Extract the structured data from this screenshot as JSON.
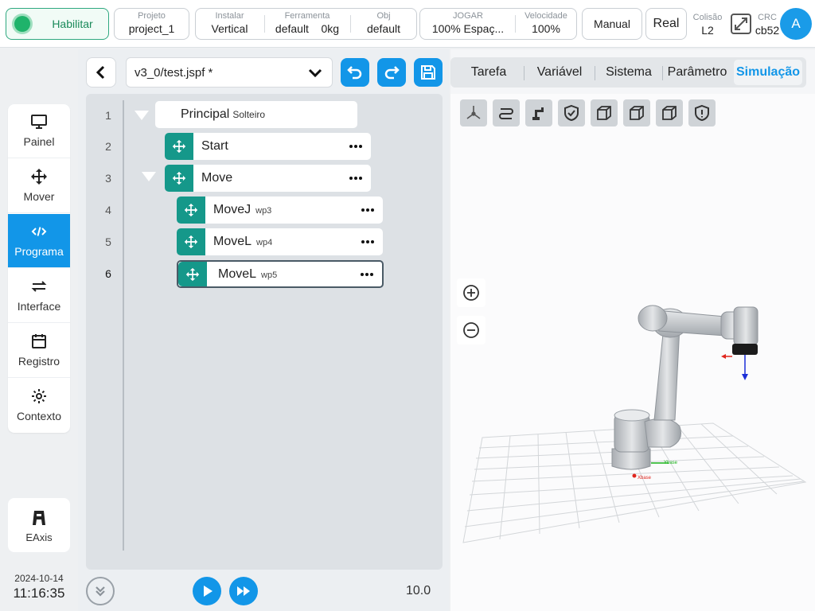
{
  "topbar": {
    "enable_label": "Habilitar",
    "project": {
      "key": "Projeto",
      "value": "project_1"
    },
    "install": {
      "key": "Instalar",
      "value": "Vertical"
    },
    "tool": {
      "key": "Ferramenta",
      "value_name": "default",
      "value_weight": "0kg"
    },
    "obj": {
      "key": "Obj",
      "value": "default"
    },
    "jog": {
      "key": "JOGAR",
      "value": "100%  Espaç..."
    },
    "speed": {
      "key": "Velocidade",
      "value": "100%"
    },
    "manual_label": "Manual",
    "real_label": "Real",
    "collision": {
      "key": "Colisão",
      "value": "L2"
    },
    "crc": {
      "key": "CRC",
      "value": "cb52"
    },
    "avatar": "A"
  },
  "nav": {
    "items": [
      {
        "label": "Painel",
        "icon": "monitor-icon"
      },
      {
        "label": "Mover",
        "icon": "move-arrows-icon"
      },
      {
        "label": "Programa",
        "icon": "code-icon"
      },
      {
        "label": "Interface",
        "icon": "swap-arrows-icon"
      },
      {
        "label": "Registro",
        "icon": "calendar-icon"
      },
      {
        "label": "Contexto",
        "icon": "gear-icon"
      }
    ],
    "active": "Programa",
    "eaxis_label": "EAxis"
  },
  "clock": {
    "date": "2024-10-14",
    "time": "11:16:35"
  },
  "program": {
    "file": "v3_0/test.jspf *",
    "lines": [
      "1",
      "2",
      "3",
      "4",
      "5",
      "6"
    ],
    "root": {
      "name": "Principal",
      "sub": "Solteiro"
    },
    "nodes": [
      {
        "name": "Start",
        "sub": ""
      },
      {
        "name": "Move",
        "sub": ""
      },
      {
        "name": "MoveJ",
        "sub": "wp3"
      },
      {
        "name": "MoveL",
        "sub": "wp4"
      },
      {
        "name": "MoveL",
        "sub": "wp5"
      }
    ],
    "speed_value": "10.0"
  },
  "tabs": {
    "items": [
      "Tarefa",
      "Variável",
      "Sistema",
      "Parâmetro",
      "Simulação"
    ],
    "active": "Simulação"
  },
  "sim": {
    "axis_x": "Xbase",
    "axis_y": "Ybase",
    "colors": {
      "accent": "#1296e8",
      "handle": "#15988a",
      "enable": "#1fb36b"
    }
  }
}
